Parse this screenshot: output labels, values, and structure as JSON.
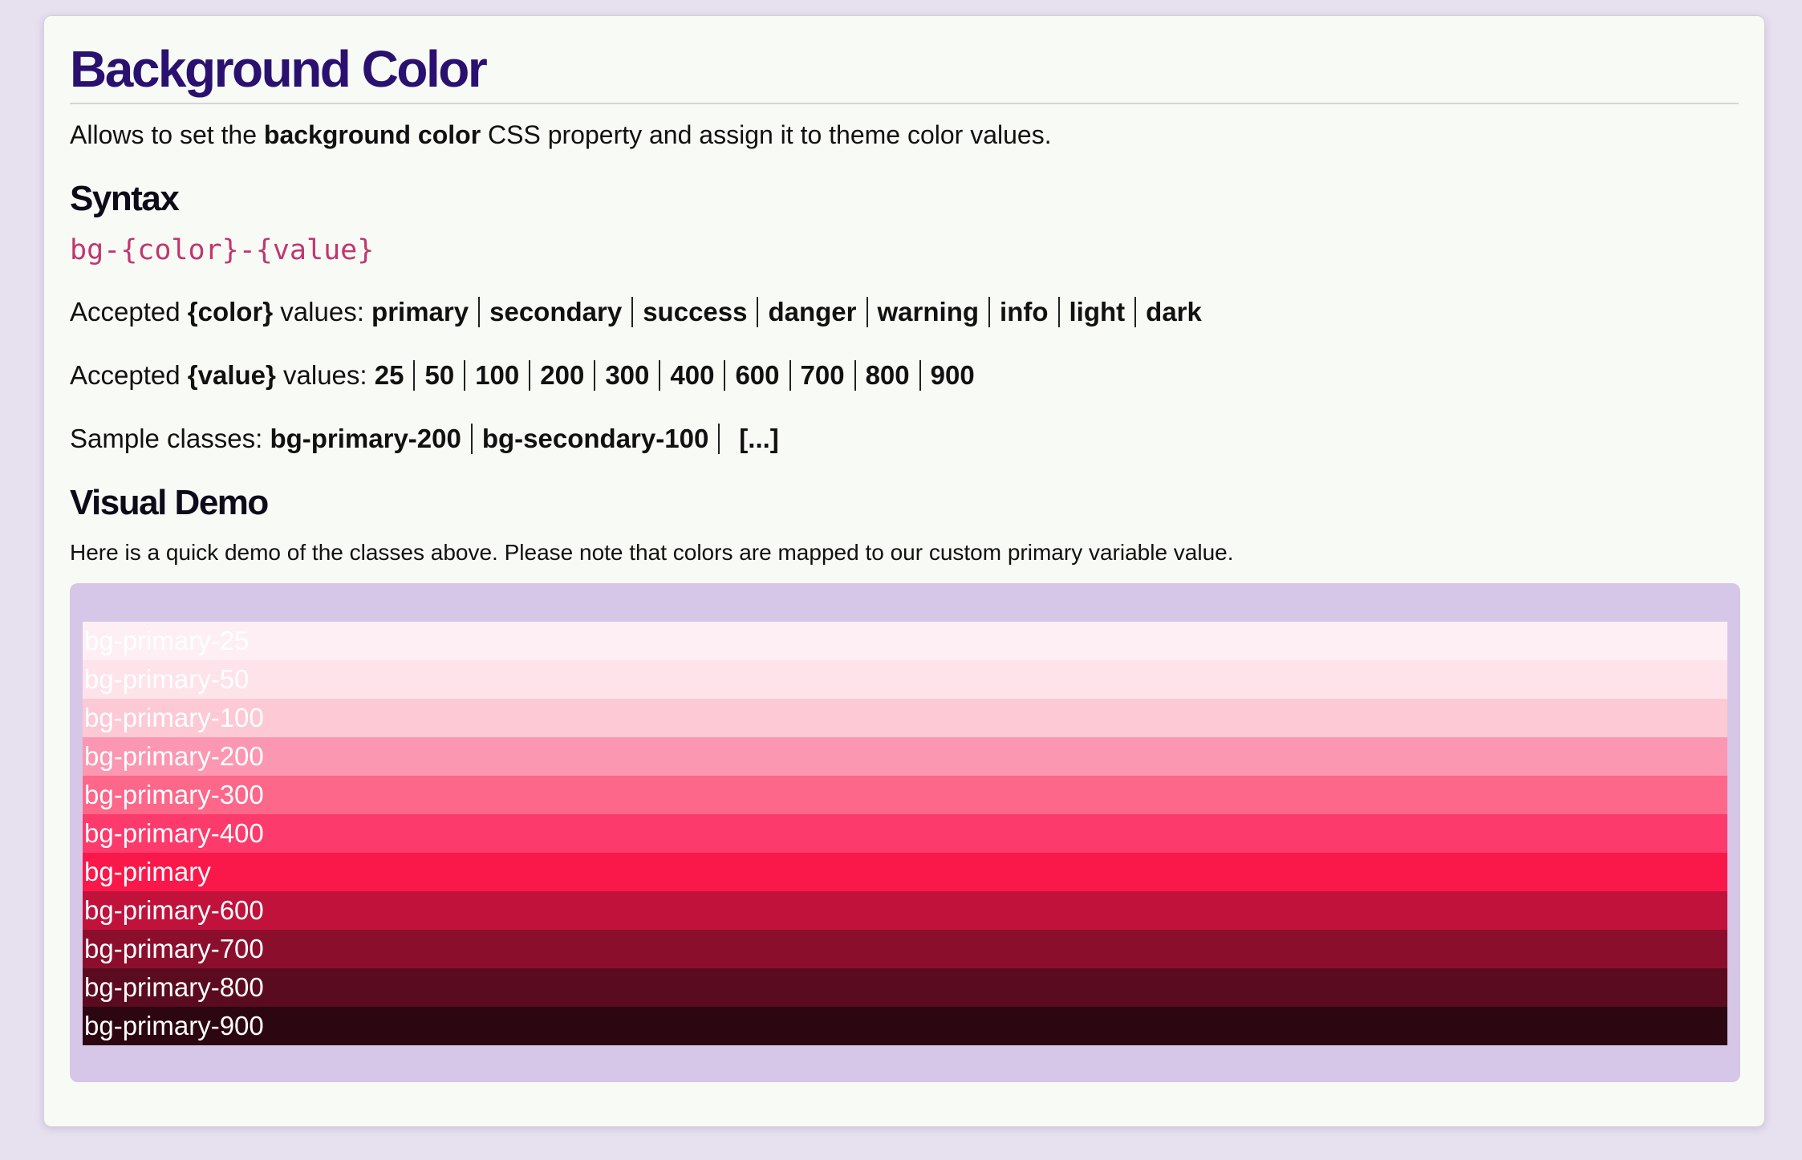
{
  "title": "Background Color",
  "intro": {
    "before": "Allows to set the ",
    "bold": "background color",
    "after": " CSS property and assign it to theme color values."
  },
  "syntax": {
    "heading": "Syntax",
    "pattern": "bg-{color}-{value}"
  },
  "accepted_color": {
    "prefix": "Accepted ",
    "token": "{color}",
    "suffix": " values: ",
    "values": [
      "primary",
      "secondary",
      "success",
      "danger",
      "warning",
      "info",
      "light",
      "dark"
    ]
  },
  "accepted_value": {
    "prefix": "Accepted ",
    "token": "{value}",
    "suffix": " values: ",
    "values": [
      "25",
      "50",
      "100",
      "200",
      "300",
      "400",
      "600",
      "700",
      "800",
      "900"
    ]
  },
  "samples": {
    "label": "Sample classes: ",
    "values": [
      "bg-primary-200",
      "bg-secondary-100"
    ],
    "more": "[...]"
  },
  "demo": {
    "heading": "Visual Demo",
    "description": "Here is a quick demo of the classes above. Please note that colors are mapped to our custom primary variable value.",
    "box_color": "#d6c6e7",
    "swatches": [
      {
        "label": "bg-primary-25",
        "color": "#fdeff3"
      },
      {
        "label": "bg-primary-50",
        "color": "#fee3ea"
      },
      {
        "label": "bg-primary-100",
        "color": "#fdc9d5"
      },
      {
        "label": "bg-primary-200",
        "color": "#fc97b1"
      },
      {
        "label": "bg-primary-300",
        "color": "#fd6789"
      },
      {
        "label": "bg-primary-400",
        "color": "#fc3a6b"
      },
      {
        "label": "bg-primary",
        "color": "#fa184b"
      },
      {
        "label": "bg-primary-600",
        "color": "#c1123c"
      },
      {
        "label": "bg-primary-700",
        "color": "#8b0f2d"
      },
      {
        "label": "bg-primary-800",
        "color": "#5a0b1f"
      },
      {
        "label": "bg-primary-900",
        "color": "#2c0610"
      }
    ]
  }
}
